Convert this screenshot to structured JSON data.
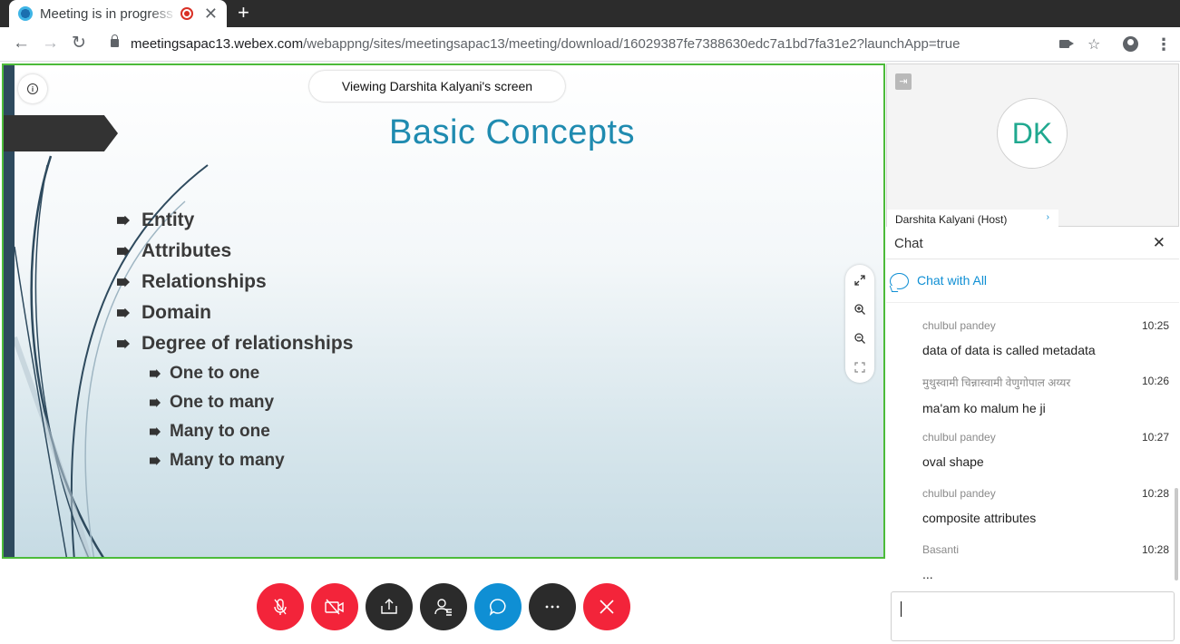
{
  "browser": {
    "tab_title": "Meeting is in progress",
    "tab_close": "✕",
    "new_tab": "+",
    "url_host": "meetingsapac13.webex.com",
    "url_path": "/webappng/sites/meetingsapac13/meeting/download/16029387fe7388630edc7a1bd7fa31e2?launchApp=true",
    "icons": [
      "back-arrow-icon",
      "forward-arrow-icon",
      "reload-icon",
      "lock-icon",
      "camera-icon",
      "star-icon",
      "account-icon",
      "kebab-menu-icon"
    ]
  },
  "share": {
    "viewing_label": "Viewing Darshita Kalyani's screen",
    "info_glyph": "i"
  },
  "slide": {
    "title": "Basic Concepts",
    "bullets": [
      "Entity",
      "Attributes",
      "Relationships",
      "Domain",
      "Degree of relationships"
    ],
    "sub_bullets": [
      "One to one",
      "One to many",
      "Many to one",
      "Many to many"
    ]
  },
  "controls": [
    "mute-icon",
    "stop-video-icon",
    "share-icon",
    "participants-icon",
    "chat-icon",
    "more-icon",
    "leave-icon"
  ],
  "video": {
    "initials": "DK",
    "name": "Darshita Kalyani (Host)",
    "accent": "#1fa88f"
  },
  "chat": {
    "title": "Chat",
    "close": "✕",
    "chat_with": "Chat with All",
    "messages": [
      {
        "sender": "chulbul pandey",
        "time": "10:25",
        "text": "data of data is called metadata"
      },
      {
        "sender": "मुथुस्वामी चिन्नास्वामी वेणुगोपाल अय्यर",
        "time": "10:26",
        "text": "ma'am ko malum he ji"
      },
      {
        "sender": "chulbul pandey",
        "time": "10:27",
        "text": "oval shape"
      },
      {
        "sender": "chulbul pandey",
        "time": "10:28",
        "text": "composite attributes"
      },
      {
        "sender": "Basanti",
        "time": "10:28",
        "text": "..."
      }
    ]
  },
  "colors": {
    "share_border": "#4cbb3a",
    "danger": "#f3243a",
    "primary": "#0f8fd4",
    "title": "#1f8bb0"
  }
}
